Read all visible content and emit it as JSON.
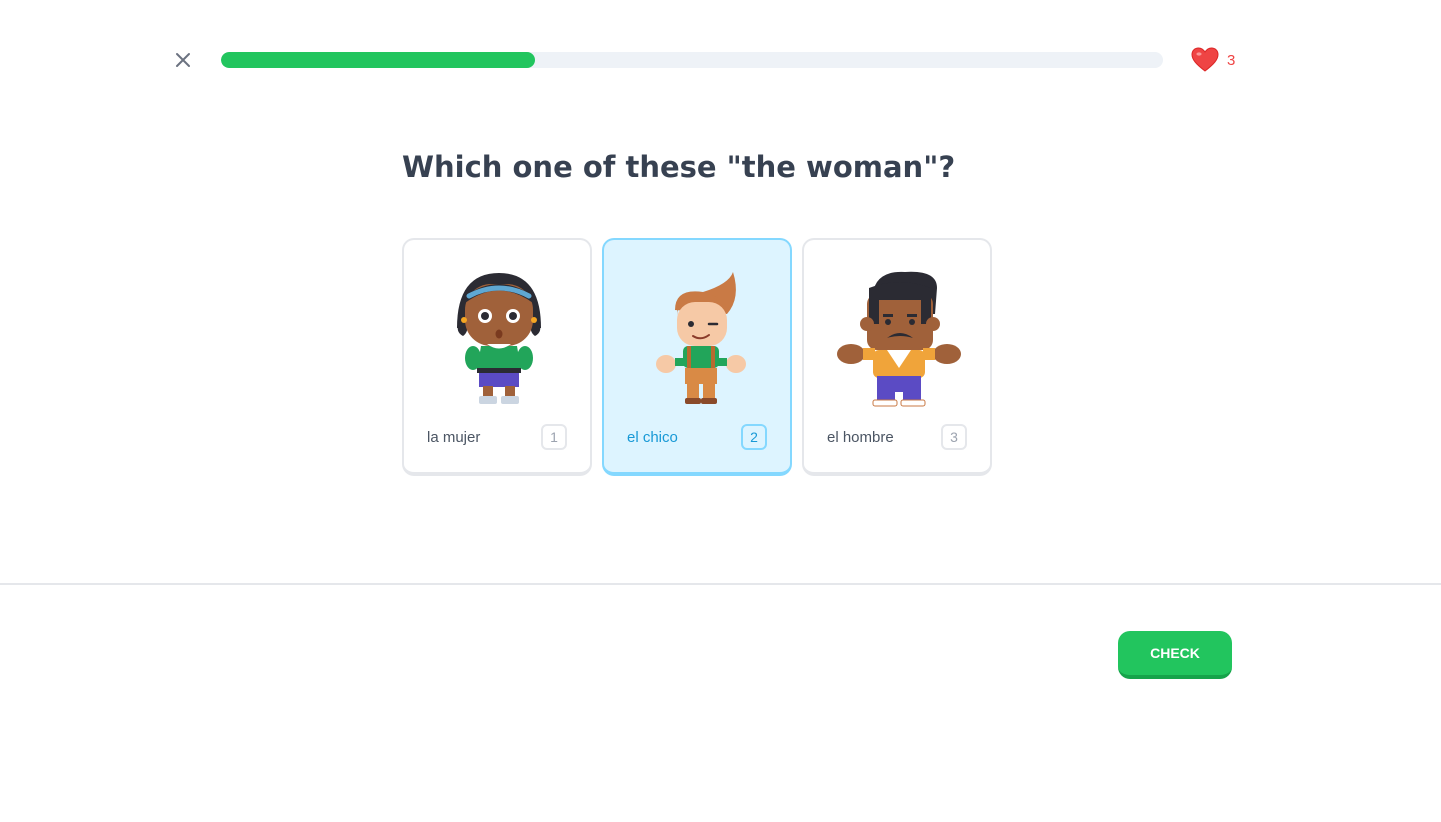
{
  "header": {
    "close_icon": "close-icon",
    "progress_fraction": 0.333,
    "hearts_icon": "heart-icon",
    "hearts": "3"
  },
  "question": "Which one of these \"the woman\"?",
  "options": [
    {
      "label": "la mujer",
      "key": "1",
      "image": "woman-character",
      "selected": false
    },
    {
      "label": "el chico",
      "key": "2",
      "image": "boy-character",
      "selected": true
    },
    {
      "label": "el hombre",
      "key": "3",
      "image": "man-character",
      "selected": false
    }
  ],
  "footer": {
    "check_label": "CHECK"
  },
  "colors": {
    "progress": "#22c55e",
    "selected_bg": "#ddf4ff",
    "selected_border": "#84d8ff",
    "selected_text": "#1899d6",
    "heart": "#ef4444",
    "button": "#22c55e"
  }
}
